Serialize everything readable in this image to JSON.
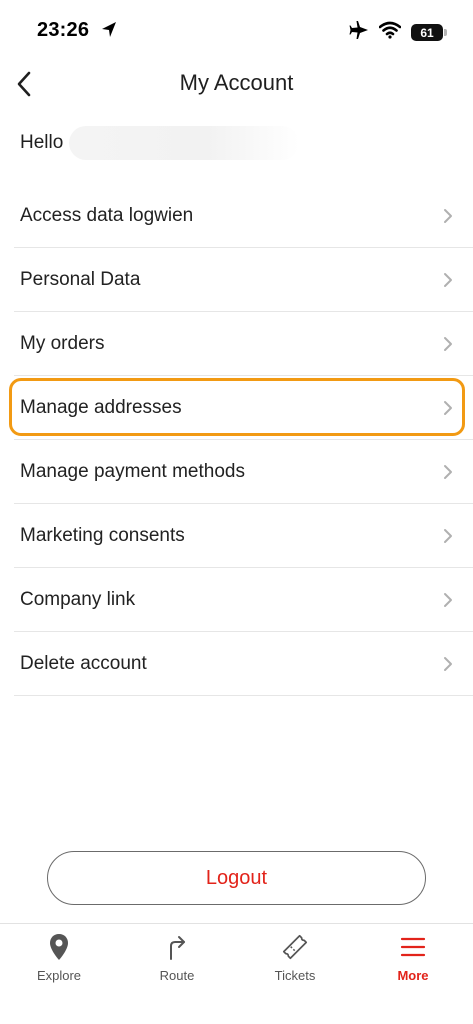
{
  "status_bar": {
    "time": "23:26",
    "battery": "61"
  },
  "header": {
    "title": "My Account"
  },
  "greeting": {
    "text": "Hello"
  },
  "menu": {
    "items": [
      {
        "label": "Access data logwien"
      },
      {
        "label": "Personal Data"
      },
      {
        "label": "My orders"
      },
      {
        "label": "Manage addresses"
      },
      {
        "label": "Manage payment methods"
      },
      {
        "label": "Marketing consents"
      },
      {
        "label": "Company link"
      },
      {
        "label": "Delete account"
      }
    ],
    "highlighted_item": "Manage addresses",
    "highlight_color": "#f29a13"
  },
  "logout": {
    "label": "Logout"
  },
  "tab_bar": {
    "tabs": [
      {
        "label": "Explore",
        "icon": "location-pin-icon"
      },
      {
        "label": "Route",
        "icon": "turn-arrow-icon"
      },
      {
        "label": "Tickets",
        "icon": "ticket-icon"
      },
      {
        "label": "More",
        "icon": "hamburger-menu-icon"
      }
    ],
    "active_tab": "More"
  },
  "colors": {
    "accent": "#e2231a",
    "highlight": "#f29a13",
    "divider": "#e6e6e6"
  }
}
